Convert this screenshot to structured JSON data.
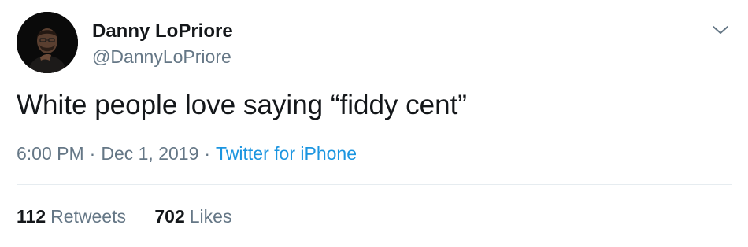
{
  "tweet": {
    "author": {
      "display_name": "Danny LoPriore",
      "handle": "@DannyLoPriore"
    },
    "text": "White people love saying “fiddy cent”",
    "time": "6:00 PM",
    "separator": "·",
    "date": "Dec 1, 2019",
    "source": "Twitter for iPhone",
    "retweets": {
      "count": "112",
      "label": "Retweets"
    },
    "likes": {
      "count": "702",
      "label": "Likes"
    }
  },
  "icons": {
    "more_menu": "chevron-down-icon"
  },
  "colors": {
    "primary_text": "#14171a",
    "secondary_text": "#657786",
    "link": "#1b95e0",
    "divider": "#e6ecf0",
    "background": "#ffffff"
  }
}
